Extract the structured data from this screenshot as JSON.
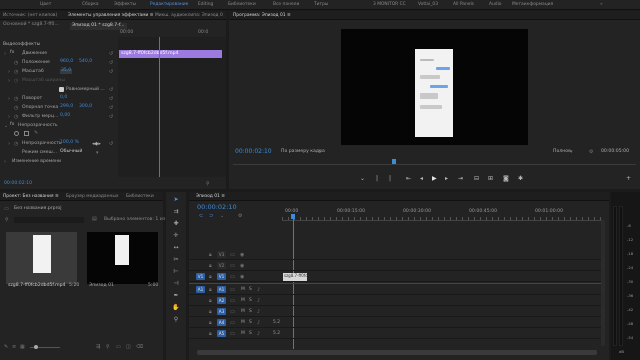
{
  "workspaces": [
    "Цвет",
    "Сборка",
    "Эффекты",
    "Редактирование",
    "Editing",
    "Библиотеки",
    "Все панели",
    "Титры",
    "3 MONITOR CC",
    "Votlai_03",
    "All Panels",
    "Audio",
    "Метаинформация"
  ],
  "active_workspace_index": 3,
  "effect_panel": {
    "tabs": [
      "Источник: (нет клипов)",
      "Элементы управления эффектами ≡",
      "Микш. аудиоклипа: Эпизод 0"
    ],
    "clip_title": "Основной * szg8.7-ff0...",
    "sequence_title": "Эпизод 01 * szg8.7-f...",
    "timecode_start": "00:00",
    "timecode_mid": "00:0",
    "section_video": "Видеоэффекты",
    "clip_bar_label": "szg8.7-ff0fcb2dbd5f.mp4",
    "motion": "Движение",
    "position_label": "Положение",
    "position_x": "960,0",
    "position_y": "540,0",
    "scale_label": "Масштаб",
    "scale_value": "35,0",
    "scale_width_label": "Масштаб ширины",
    "uniform_scale_label": "Равномерный ...",
    "rotation_label": "Поворот",
    "rotation_value": "0,0",
    "anchor_label": "Опорная точка",
    "anchor_x": "299,0",
    "anchor_y": "300,0",
    "flicker_label": "Фильтр мерц...",
    "flicker_value": "0,00",
    "opacity_section": "Непрозрачность",
    "opacity_label": "Непрозрачность",
    "opacity_value": "100,0 %",
    "blend_label": "Режим смеш...",
    "blend_value": "Обычный",
    "time_remap": "Изменение времени",
    "bottom_timecode": "00:00:02:10"
  },
  "program_monitor": {
    "title": "Программа: Эпизод 01 ≡",
    "timecode": "00:00:02:10",
    "fit": "По размеру кадра",
    "quality": "Полное",
    "duration": "00:00:05:00",
    "buttons": [
      "marker-icon",
      "mark-in-icon",
      "mark-out-icon",
      "go-to-in-icon",
      "step-back-icon",
      "play-icon",
      "step-forward-icon",
      "go-to-out-icon",
      "insert-icon",
      "overwrite-icon",
      "export-frame-icon",
      "settings-icon",
      "plus-icon"
    ]
  },
  "project_panel": {
    "tabs": [
      "Проект: Без названия ≡",
      "Браузер медиаданных",
      "Библиотеки"
    ],
    "project_file": "Без названия.prproj",
    "selection": "Выбрано элементов: 1 из 2",
    "items": [
      {
        "name": "szg8.7-ff0fcb2dbd5f.mp4",
        "duration": "5:20"
      },
      {
        "name": "Эпизод 01",
        "duration": "5:00"
      }
    ]
  },
  "timeline": {
    "tab": "Эпизод 01 ≡",
    "timecode": "00:00:02:10",
    "ruler": [
      "00:00",
      "00:00:15:00",
      "00:00:30:00",
      "00:00:45:00",
      "00:01:00:00"
    ],
    "video_tracks": [
      "V3",
      "V2",
      "V1"
    ],
    "audio_tracks": [
      "A1",
      "A2",
      "A3",
      "A4",
      "A5"
    ],
    "source_v": "V1",
    "source_a": "A1",
    "clip_label": "szg8.7-ff0fc",
    "audio_values": [
      "",
      "",
      "",
      "5.2",
      "5.2"
    ],
    "meter_labels": [
      "-6",
      "-12",
      "-18",
      "-24",
      "-30",
      "-36",
      "-42",
      "-48",
      "-54"
    ],
    "meter_footer": "dB"
  }
}
